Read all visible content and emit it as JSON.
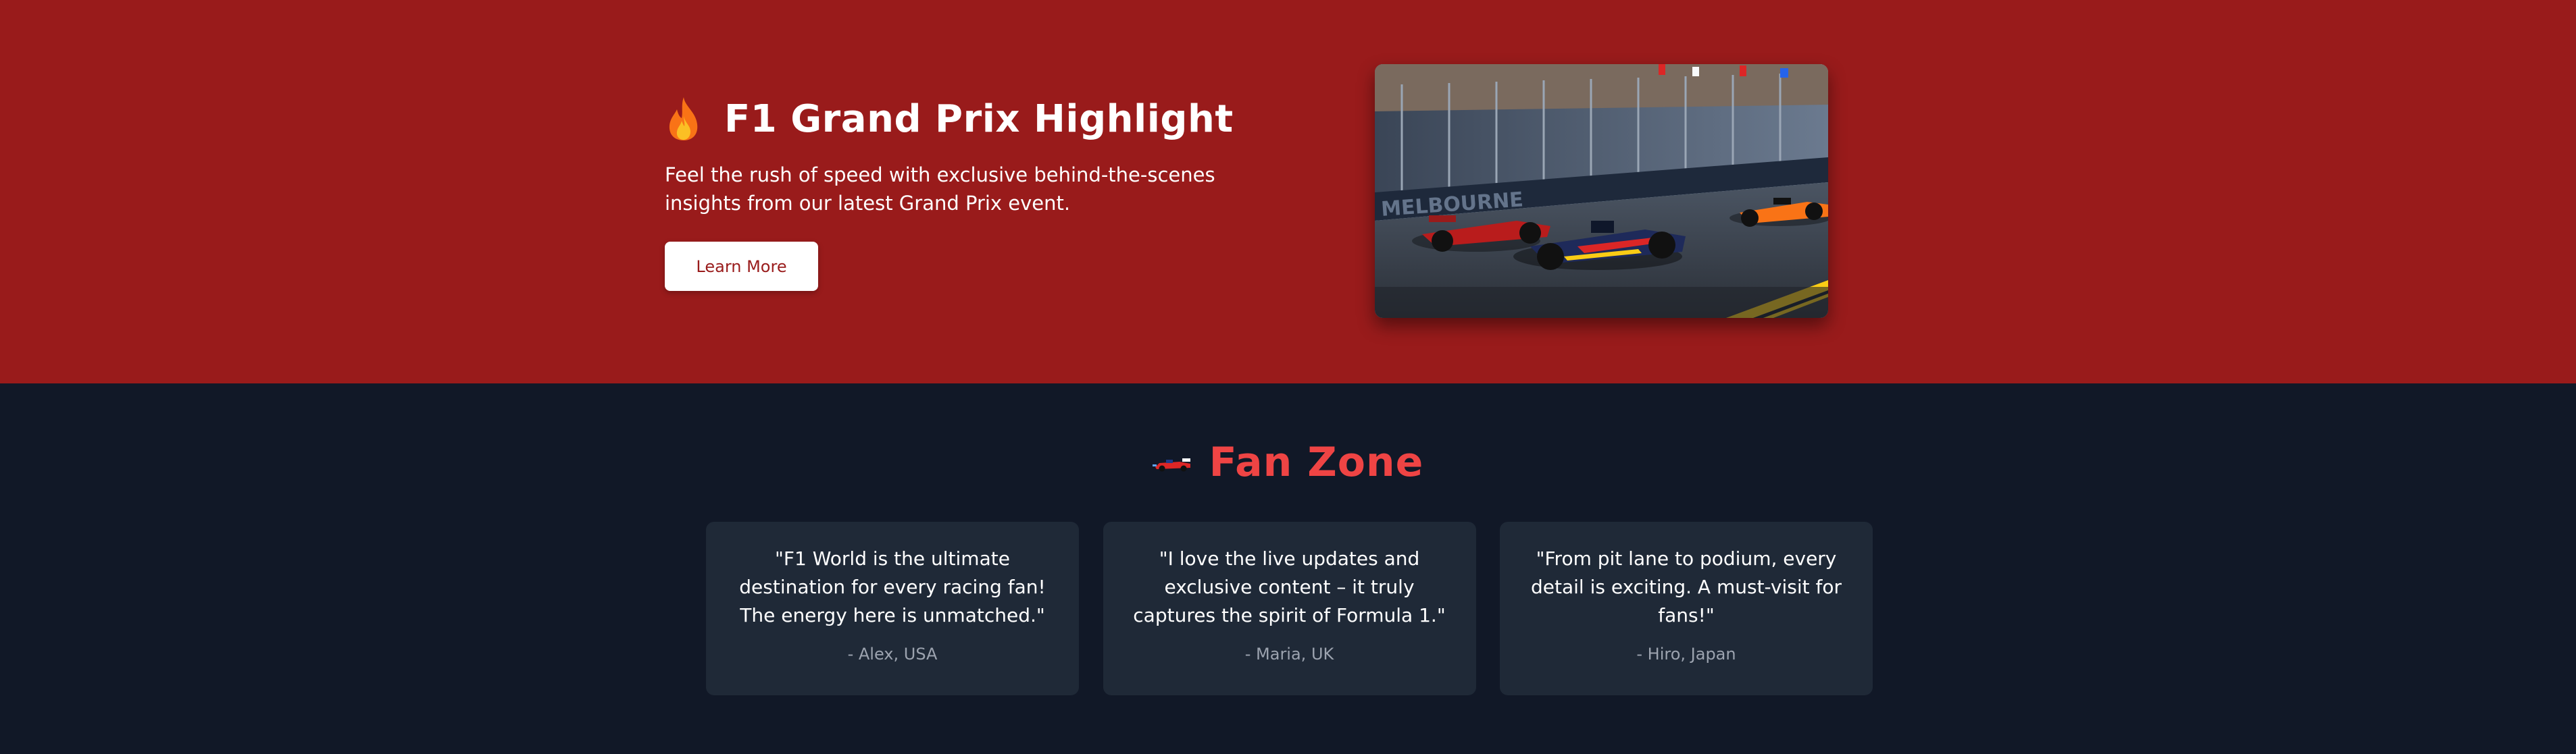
{
  "hero": {
    "title": "F1 Grand Prix Highlight",
    "description": "Feel the rush of speed with exclusive behind-the-scenes insights from our latest Grand Prix event.",
    "button_label": "Learn More",
    "title_icon": "fire-icon",
    "image": {
      "alt": "F1 race cars on the Melbourne circuit",
      "track_text": "MELBOURNE"
    }
  },
  "fan_zone": {
    "heading": "Fan Zone",
    "heading_icon": "race-car-icon",
    "testimonials": [
      {
        "quote": "\"F1 World is the ultimate destination for every racing fan! The energy here is unmatched.\"",
        "author": "- Alex, USA"
      },
      {
        "quote": "\"I love the live updates and exclusive content – it truly captures the spirit of Formula 1.\"",
        "author": "- Maria, UK"
      },
      {
        "quote": "\"From pit lane to podium, every detail is exciting. A must-visit for fans!\"",
        "author": "- Hiro, Japan"
      }
    ]
  },
  "colors": {
    "hero_bg": "#991b1b",
    "page_bg": "#111827",
    "card_bg": "#1f2937",
    "accent_red": "#ef4444",
    "muted_text": "#9ca3af"
  }
}
